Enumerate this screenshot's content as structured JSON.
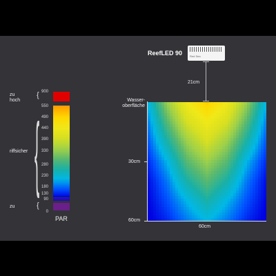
{
  "fixture": {
    "name": "ReefLED 90",
    "brand": "Red Sea",
    "distance_label": "21cm"
  },
  "water_surface_label_1": "Wasser-",
  "water_surface_label_2": "oberfläche",
  "legend": {
    "title": "PAR",
    "groups": {
      "too_high_1": "zu",
      "too_high_2": "hoch",
      "reef_safe": "riffsicher",
      "too_low": "zu"
    },
    "ticks": [
      "900",
      "550",
      "490",
      "440",
      "390",
      "330",
      "280",
      "230",
      "180",
      "130",
      "90",
      "0"
    ]
  },
  "chart_data": {
    "type": "heatmap",
    "title": "",
    "xlabel": "60cm",
    "ylabel": "",
    "x_ticks": [
      "60cm"
    ],
    "y_ticks": [
      "30cm",
      "60cm"
    ],
    "xlim": [
      0,
      60
    ],
    "ylim": [
      0,
      60
    ],
    "value_label": "PAR",
    "colorscale": [
      {
        "par": 0,
        "color": "#6a1f8a"
      },
      {
        "par": 90,
        "color": "#0000e0"
      },
      {
        "par": 130,
        "color": "#0050ff"
      },
      {
        "par": 180,
        "color": "#00b8e6"
      },
      {
        "par": 230,
        "color": "#18b0a8"
      },
      {
        "par": 280,
        "color": "#58b870"
      },
      {
        "par": 330,
        "color": "#9ed04a"
      },
      {
        "par": 390,
        "color": "#d8e020"
      },
      {
        "par": 440,
        "color": "#f0e818"
      },
      {
        "par": 490,
        "color": "#ffd800"
      },
      {
        "par": 550,
        "color": "#ff9a00"
      },
      {
        "par": 900,
        "color": "#e00000"
      }
    ],
    "x": [
      0,
      10,
      20,
      30,
      40,
      50,
      60
    ],
    "y": [
      0,
      10,
      20,
      30,
      40,
      50,
      60
    ],
    "z": [
      [
        180,
        330,
        440,
        500,
        440,
        330,
        180
      ],
      [
        150,
        280,
        390,
        440,
        390,
        280,
        150
      ],
      [
        130,
        230,
        330,
        390,
        330,
        230,
        130
      ],
      [
        110,
        180,
        280,
        330,
        280,
        180,
        110
      ],
      [
        95,
        150,
        230,
        280,
        230,
        150,
        95
      ],
      [
        90,
        130,
        180,
        230,
        180,
        130,
        90
      ],
      [
        85,
        110,
        150,
        180,
        150,
        110,
        85
      ]
    ]
  }
}
